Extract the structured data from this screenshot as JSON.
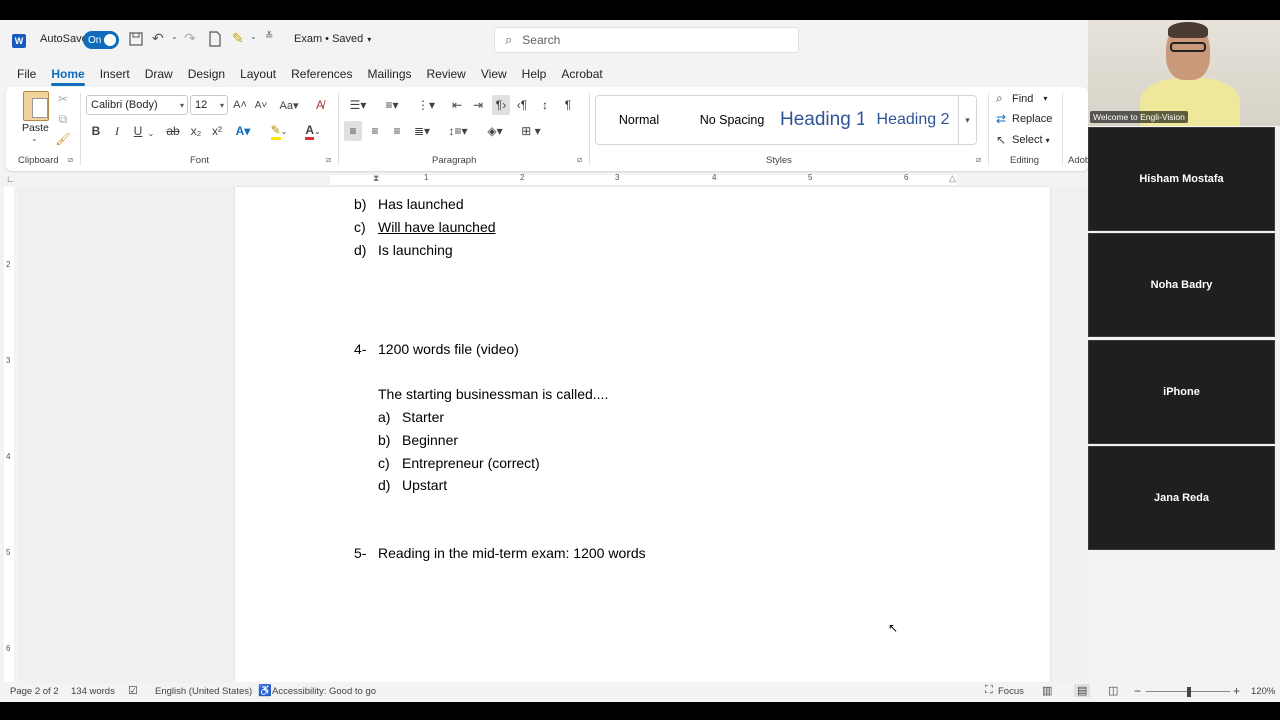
{
  "titlebar": {
    "autosave_label": "AutoSave",
    "autosave_state": "On",
    "document_title": "Exam • Saved",
    "search_placeholder": "Search"
  },
  "menu": [
    "File",
    "Home",
    "Insert",
    "Draw",
    "Design",
    "Layout",
    "References",
    "Mailings",
    "Review",
    "View",
    "Help",
    "Acrobat"
  ],
  "ribbon": {
    "clipboard": {
      "paste_label": "Paste",
      "group_label": "Clipboard"
    },
    "font": {
      "font_name": "Calibri (Body)",
      "font_size": "12",
      "group_label": "Font"
    },
    "paragraph": {
      "group_label": "Paragraph"
    },
    "styles": {
      "items": [
        "Normal",
        "No Spacing",
        "Heading 1",
        "Heading 2"
      ],
      "group_label": "Styles"
    },
    "editing": {
      "find": "Find",
      "replace": "Replace",
      "select": "Select",
      "group_label": "Editing"
    },
    "adobe_partial": "Adob"
  },
  "ruler_numbers": [
    "1",
    "2",
    "3",
    "4",
    "5",
    "6"
  ],
  "vruler_numbers": [
    "2",
    "3",
    "4",
    "5",
    "6"
  ],
  "document": {
    "q3_options": [
      {
        "marker": "b)",
        "text": "Has launched"
      },
      {
        "marker": "c)",
        "text": "Will have launched"
      },
      {
        "marker": "d)",
        "text": "Is launching"
      }
    ],
    "q4": {
      "number": "4-",
      "title": "1200 words file (video)",
      "prompt": "The starting businessman is called....",
      "options": [
        {
          "marker": "a)",
          "text": "Starter"
        },
        {
          "marker": "b)",
          "text": "Beginner"
        },
        {
          "marker": "c)",
          "text": "Entrepreneur (correct)"
        },
        {
          "marker": "d)",
          "text": "Upstart"
        }
      ]
    },
    "q5": {
      "number": "5-",
      "title": "Reading in the mid-term exam: 1200 words"
    }
  },
  "statusbar": {
    "page": "Page 2 of 2",
    "words": "134 words",
    "language": "English (United States)",
    "accessibility": "Accessibility: Good to go",
    "focus": "Focus",
    "zoom": "120%"
  },
  "meeting": {
    "self_caption": "Welcome to Engli-Vision",
    "participants": [
      "Hisham Mostafa",
      "Noha Badry",
      "iPhone",
      "Jana Reda"
    ]
  },
  "colors": {
    "accent": "#0f6cbd",
    "heading": "#2f5496"
  }
}
